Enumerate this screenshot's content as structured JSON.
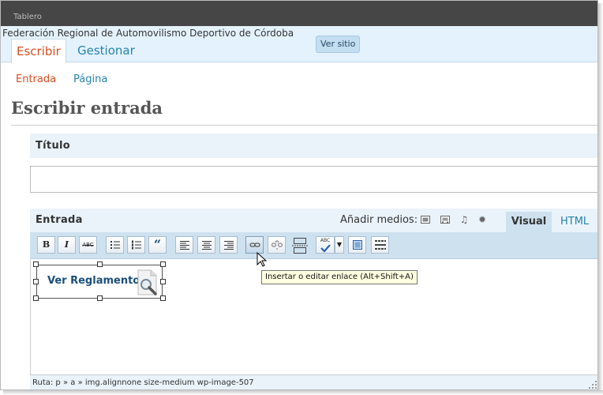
{
  "topbar": {
    "label": "Tablero"
  },
  "header": {
    "site_title": "Federación Regional de Automovilismo Deportivo de Córdoba",
    "view_site_label": "Ver sitio",
    "tabs": [
      {
        "label": "Escribir"
      },
      {
        "label": "Gestionar"
      }
    ]
  },
  "submenu": {
    "items": [
      {
        "label": "Entrada"
      },
      {
        "label": "Página"
      }
    ]
  },
  "page": {
    "title": "Escribir entrada"
  },
  "title_box": {
    "label": "Título",
    "value": ""
  },
  "post_box": {
    "label": "Entrada",
    "media_label": "Añadir medios:",
    "tabs": [
      {
        "label": "Visual"
      },
      {
        "label": "HTML"
      }
    ]
  },
  "toolbar": {
    "buttons": [
      {
        "icon": "bold-icon",
        "glyph": "B"
      },
      {
        "icon": "italic-icon",
        "glyph": "I"
      },
      {
        "icon": "strikethrough-icon",
        "glyph": "ABC"
      },
      {
        "icon": "bulleted-list-icon"
      },
      {
        "icon": "numbered-list-icon"
      },
      {
        "icon": "blockquote-icon",
        "glyph": "“"
      },
      {
        "icon": "align-left-icon"
      },
      {
        "icon": "align-center-icon"
      },
      {
        "icon": "align-right-icon"
      },
      {
        "icon": "link-icon"
      },
      {
        "icon": "unlink-icon"
      },
      {
        "icon": "more-tag-icon"
      },
      {
        "icon": "spellcheck-icon",
        "glyph": "ABC"
      },
      {
        "icon": "fullscreen-icon"
      },
      {
        "icon": "kitchen-sink-icon"
      }
    ],
    "tooltip": "Insertar o editar enlace (Alt+Shift+A)"
  },
  "editor": {
    "image_link_text": "Ver Reglamento"
  },
  "status": {
    "path": "Ruta: p » a » img.alignnone size-medium wp-image-507"
  },
  "colors": {
    "accent": "#d54e21",
    "link": "#2583ad",
    "header_bg": "#e4f2fd",
    "topbar_bg": "#464646"
  }
}
